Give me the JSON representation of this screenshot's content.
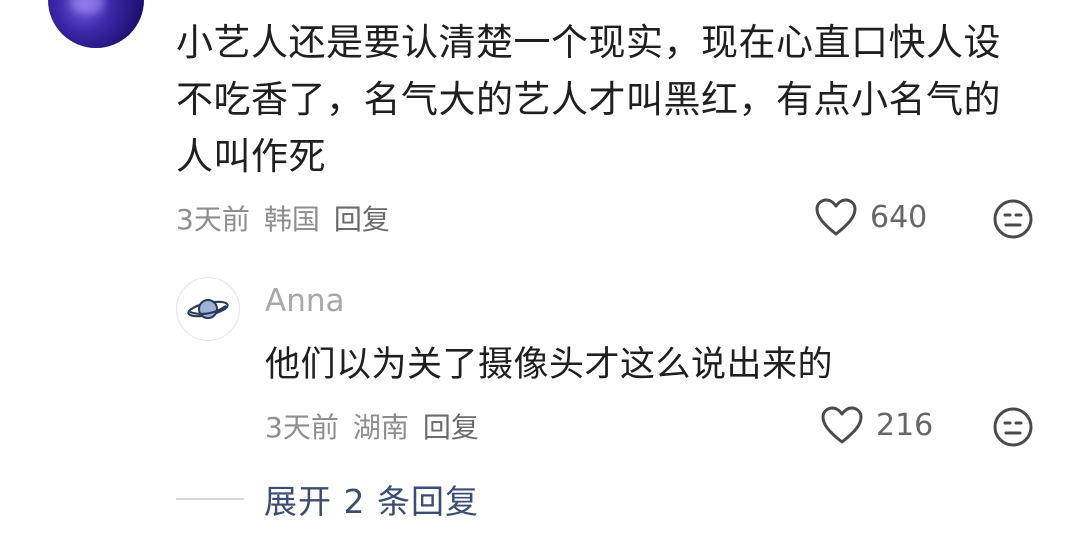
{
  "main_comment": {
    "text_lines": [
      "小艺人还是要认清楚一个现实，现在心直口快人设",
      "不吃香了，名气大的艺人才叫黑红，有点小名气的",
      "人叫作死"
    ],
    "time": "3天前",
    "location": "韩国",
    "reply_label": "回复",
    "likes": "640"
  },
  "reply": {
    "author": "Anna",
    "text": "他们以为关了摄像头才这么说出来的",
    "time": "3天前",
    "location": "湖南",
    "reply_label": "回复",
    "likes": "216"
  },
  "expand_replies": {
    "label": "展开 2 条回复"
  },
  "icons": {
    "like": "heart-outline-icon",
    "dislike": "neutral-face-icon",
    "reply_avatar": "planet-icon"
  },
  "colors": {
    "text_primary": "#1f1f1f",
    "text_meta": "#8e8e8e",
    "link_blue": "#3b4d73"
  }
}
